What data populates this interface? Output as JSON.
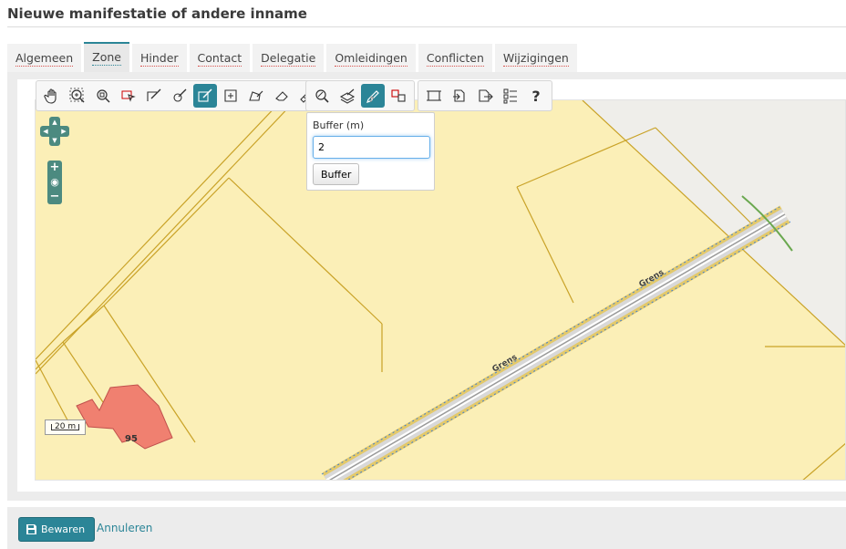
{
  "page": {
    "title": "Nieuwe manifestatie of andere inname"
  },
  "tabs": [
    {
      "label": "Algemeen",
      "active": false
    },
    {
      "label": "Zone",
      "active": true
    },
    {
      "label": "Hinder",
      "active": false
    },
    {
      "label": "Contact",
      "active": false
    },
    {
      "label": "Delegatie",
      "active": false
    },
    {
      "label": "Omleidingen",
      "active": false
    },
    {
      "label": "Conflicten",
      "active": false
    },
    {
      "label": "Wijzigingen",
      "active": false
    }
  ],
  "toolbar": {
    "help_label": "?",
    "active_tool": "edit-geometry",
    "buffer_active_tool": "buffer"
  },
  "buffer_popup": {
    "label": "Buffer (m)",
    "value": "2",
    "button_label": "Buffer"
  },
  "map": {
    "scale_label": "20 m",
    "street_label_1": "Grens",
    "street_label_2": "Grens",
    "parcel_number": "95",
    "colors": {
      "parcel_fill": "#fbefb7",
      "parcel_border": "#c9a227",
      "building_fill": "#f08070",
      "road": "#c8c8c8",
      "accent": "#2b8597"
    }
  },
  "footer": {
    "save_label": "Bewaren",
    "cancel_label": "Annuleren"
  }
}
